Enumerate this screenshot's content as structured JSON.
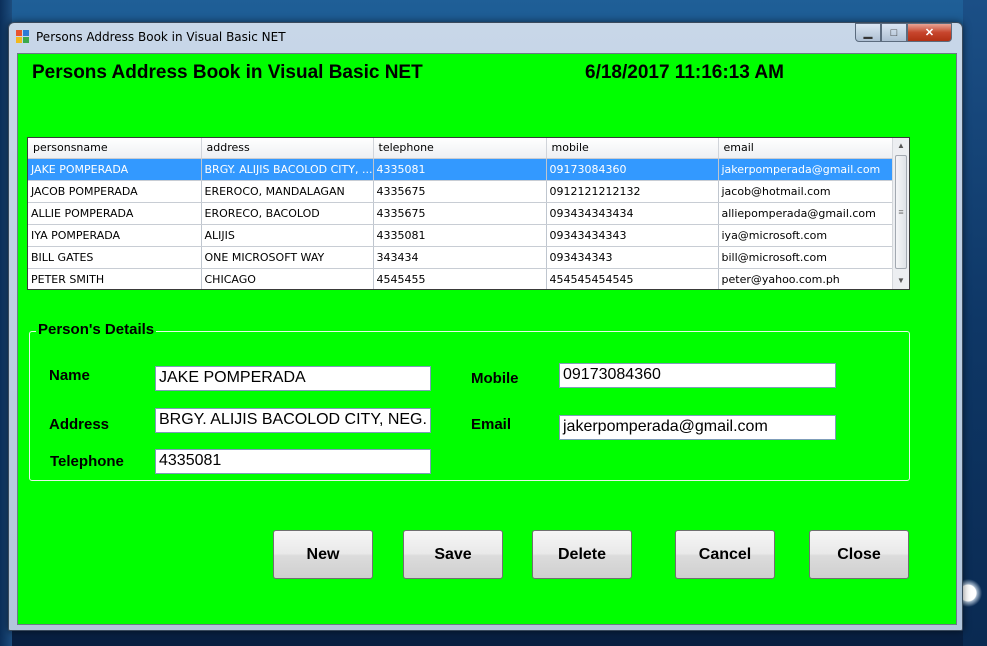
{
  "window": {
    "title": "Persons Address Book in Visual Basic NET",
    "min_glyph": "▁",
    "max_glyph": "□",
    "close_glyph": "✕"
  },
  "header": {
    "title": "Persons Address Book in Visual Basic NET",
    "datetime": "6/18/2017 11:16:13 AM"
  },
  "grid": {
    "columns": [
      "personsname",
      "address",
      "telephone",
      "mobile",
      "email"
    ],
    "rows": [
      [
        "JAKE POMPERADA",
        "BRGY. ALIJIS BACOLOD CITY, ...",
        "4335081",
        "09173084360",
        "jakerpomperada@gmail.com"
      ],
      [
        "JACOB POMPERADA",
        "EREROCO, MANDALAGAN",
        "4335675",
        "0912121212132",
        "jacob@hotmail.com"
      ],
      [
        "ALLIE POMPERADA",
        "ERORECO, BACOLOD",
        "4335675",
        "093434343434",
        "alliepomperada@gmail.com"
      ],
      [
        "IYA POMPERADA",
        "ALIJIS",
        "4335081",
        "09343434343",
        "iya@microsoft.com"
      ],
      [
        "BILL GATES",
        "ONE MICROSOFT WAY",
        "343434",
        "093434343",
        "bill@microsoft.com"
      ],
      [
        "PETER SMITH",
        "CHICAGO",
        "4545455",
        "454545454545",
        "peter@yahoo.com.ph"
      ]
    ],
    "selected_row": 0,
    "selection_color": "#3399ff"
  },
  "details": {
    "legend": "Person's Details",
    "name_label": "Name",
    "name_value": "JAKE POMPERADA",
    "address_label": "Address",
    "address_value": "BRGY. ALIJIS BACOLOD CITY, NEG. OCC.",
    "telephone_label": "Telephone",
    "telephone_value": "4335081",
    "mobile_label": "Mobile",
    "mobile_value": "09173084360",
    "email_label": "Email",
    "email_value": "jakerpomperada@gmail.com"
  },
  "buttons": {
    "new": "New",
    "save": "Save",
    "delete": "Delete",
    "cancel": "Cancel",
    "close": "Close"
  },
  "colors": {
    "form_background": "#00ff00"
  }
}
